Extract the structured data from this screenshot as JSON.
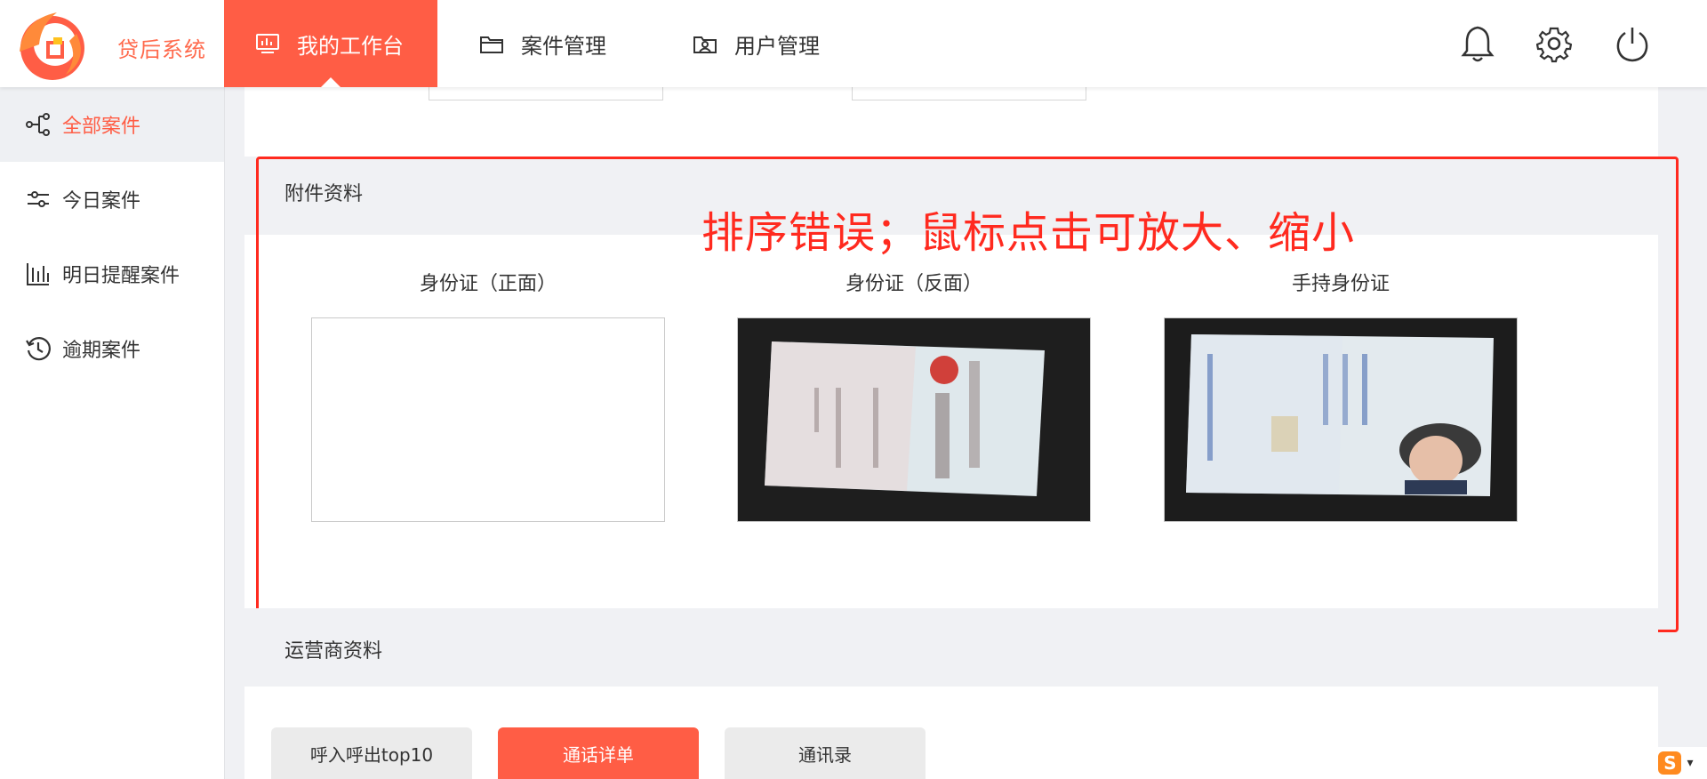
{
  "app": {
    "brand": "贷后系统"
  },
  "colors": {
    "accent": "#ff5d45",
    "annotation": "#ff2a1f",
    "sidebar_active_bg": "#eef0f3"
  },
  "header": {
    "tabs": [
      {
        "label": "我的工作台",
        "icon": "monitor-icon",
        "active": true
      },
      {
        "label": "案件管理",
        "icon": "folder-icon",
        "active": false
      },
      {
        "label": "用户管理",
        "icon": "user-card-icon",
        "active": false
      }
    ],
    "actions": [
      "bell-icon",
      "gear-icon",
      "power-icon"
    ]
  },
  "sidebar": {
    "items": [
      {
        "label": "全部案件",
        "icon": "tree-icon",
        "active": true
      },
      {
        "label": "今日案件",
        "icon": "sliders-icon",
        "active": false
      },
      {
        "label": "明日提醒案件",
        "icon": "bar-chart-icon",
        "active": false
      },
      {
        "label": "逾期案件",
        "icon": "clock-history-icon",
        "active": false
      }
    ]
  },
  "attachments": {
    "section_title": "附件资料",
    "items": [
      {
        "label": "身份证（正面）",
        "image": "empty"
      },
      {
        "label": "身份证（反面）",
        "image": "id-card-back-photo"
      },
      {
        "label": "手持身份证",
        "image": "id-card-front-photo"
      }
    ]
  },
  "annotation": {
    "text": "排序错误；鼠标点击可放大、缩小"
  },
  "operator": {
    "section_title": "运营商资料"
  },
  "tabs": [
    {
      "label": "呼入呼出top10",
      "active": false
    },
    {
      "label": "通话详单",
      "active": true
    },
    {
      "label": "通讯录",
      "active": false
    }
  ]
}
